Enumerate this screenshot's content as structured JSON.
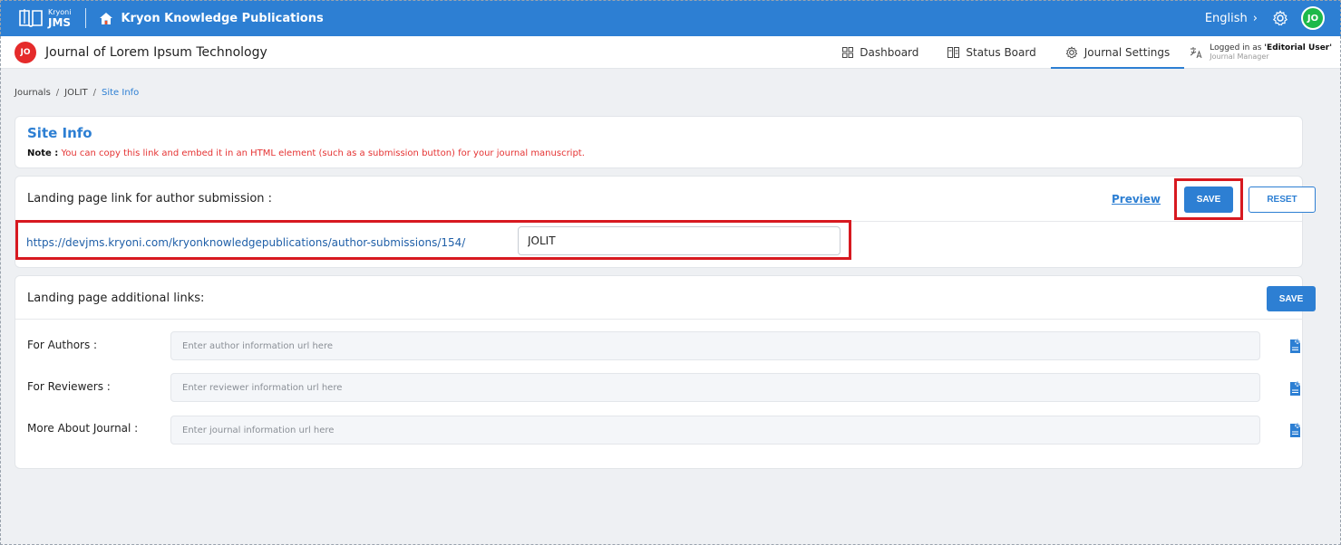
{
  "topbar": {
    "brand_small": "Kryoni",
    "brand_big": "JMS",
    "org_name": "Kryon Knowledge Publications",
    "language": "English",
    "language_chevron": "›",
    "user_initials": "JO",
    "colors": {
      "bar": "#2d7fd3",
      "avatar": "#1db94a"
    }
  },
  "subbar": {
    "journal_badge": "JO",
    "journal_title": "Journal of Lorem Ipsum Technology",
    "nav": [
      {
        "label": "Dashboard",
        "icon": "grid-icon"
      },
      {
        "label": "Status Board",
        "icon": "board-icon"
      },
      {
        "label": "Journal Settings",
        "icon": "settings-icon",
        "active": true
      }
    ],
    "logged_prefix": "Logged in as ",
    "logged_user": "'Editorial User'",
    "logged_role": "Journal Manager"
  },
  "breadcrumb": {
    "items": [
      "Journals",
      "JOLIT",
      "Site Info"
    ],
    "separator": "/"
  },
  "site_info": {
    "title": "Site Info",
    "note_label": "Note :",
    "note_text": " You can copy this link and embed it in an HTML element (such as a submission button) for your journal manuscript."
  },
  "landing": {
    "label": "Landing page link for author submission :",
    "preview": "Preview",
    "save": "SAVE",
    "reset": "RESET",
    "url_prefix": "https://devjms.kryoni.com/kryonknowledgepublications/author-submissions/154/",
    "url_value": "JOLIT"
  },
  "additional": {
    "label": "Landing page additional links:",
    "save": "SAVE",
    "rows": [
      {
        "label": "For Authors :",
        "placeholder": "Enter author information url here",
        "icon": "add-file-icon"
      },
      {
        "label": "For Reviewers :",
        "placeholder": "Enter reviewer information url here",
        "icon": "add-file-icon"
      },
      {
        "label": "More About Journal :",
        "placeholder": "Enter journal information url here",
        "icon": "add-file-icon"
      }
    ]
  }
}
